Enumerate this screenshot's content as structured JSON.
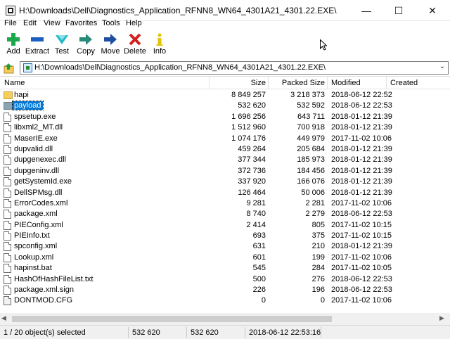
{
  "window": {
    "title": "H:\\Downloads\\Dell\\Diagnostics_Application_RFNN8_WN64_4301A21_4301.22.EXE\\",
    "minimize_glyph": "—",
    "maximize_glyph": "☐",
    "close_glyph": "✕"
  },
  "menu": {
    "file": "File",
    "edit": "Edit",
    "view": "View",
    "favorites": "Favorites",
    "tools": "Tools",
    "help": "Help"
  },
  "toolbar": {
    "add": "Add",
    "extract": "Extract",
    "test": "Test",
    "copy": "Copy",
    "move": "Move",
    "delete": "Delete",
    "info": "Info",
    "icons": [
      "plus-icon",
      "minus-icon",
      "test-icon",
      "copy-arrow-icon",
      "move-arrow-icon",
      "delete-x-icon",
      "info-icon"
    ],
    "colors": {
      "add": "#1aa84a",
      "extract": "#1d5fc0",
      "test": "#21b8c8",
      "copy": "#2a8a7a",
      "move": "#1d4ea0",
      "delete": "#d21f1f",
      "info": "#e6c200"
    }
  },
  "address": {
    "path": "H:\\Downloads\\Dell\\Diagnostics_Application_RFNN8_WN64_4301A21_4301.22.EXE\\",
    "dropdown_glyph": "⌄"
  },
  "columns": {
    "name": "Name",
    "size": "Size",
    "packed": "Packed Size",
    "modified": "Modified",
    "created": "Created"
  },
  "files": [
    {
      "name": "hapi",
      "size": "8 849 257",
      "packed": "3 218 373",
      "modified": "2018-06-12 22:52",
      "icon": "folder"
    },
    {
      "name": "payload",
      "size": "532 620",
      "packed": "532 592",
      "modified": "2018-06-12 22:53",
      "icon": "folder-selected",
      "selected": true
    },
    {
      "name": "spsetup.exe",
      "size": "1 696 256",
      "packed": "643 711",
      "modified": "2018-01-12 21:39",
      "icon": "file"
    },
    {
      "name": "libxml2_MT.dll",
      "size": "1 512 960",
      "packed": "700 918",
      "modified": "2018-01-12 21:39",
      "icon": "file"
    },
    {
      "name": "MaserIE.exe",
      "size": "1 074 176",
      "packed": "449 979",
      "modified": "2017-11-02 10:06",
      "icon": "file"
    },
    {
      "name": "dupvalid.dll",
      "size": "459 264",
      "packed": "205 684",
      "modified": "2018-01-12 21:39",
      "icon": "file"
    },
    {
      "name": "dupgenexec.dll",
      "size": "377 344",
      "packed": "185 973",
      "modified": "2018-01-12 21:39",
      "icon": "file"
    },
    {
      "name": "dupgeninv.dll",
      "size": "372 736",
      "packed": "184 456",
      "modified": "2018-01-12 21:39",
      "icon": "file"
    },
    {
      "name": "getSystemId.exe",
      "size": "337 920",
      "packed": "166 076",
      "modified": "2018-01-12 21:39",
      "icon": "file"
    },
    {
      "name": "DellSPMsg.dll",
      "size": "126 464",
      "packed": "50 006",
      "modified": "2018-01-12 21:39",
      "icon": "file"
    },
    {
      "name": "ErrorCodes.xml",
      "size": "9 281",
      "packed": "2 281",
      "modified": "2017-11-02 10:06",
      "icon": "file"
    },
    {
      "name": "package.xml",
      "size": "8 740",
      "packed": "2 279",
      "modified": "2018-06-12 22:53",
      "icon": "file"
    },
    {
      "name": "PIEConfig.xml",
      "size": "2 414",
      "packed": "805",
      "modified": "2017-11-02 10:15",
      "icon": "file"
    },
    {
      "name": "PIEInfo.txt",
      "size": "693",
      "packed": "375",
      "modified": "2017-11-02 10:15",
      "icon": "file"
    },
    {
      "name": "spconfig.xml",
      "size": "631",
      "packed": "210",
      "modified": "2018-01-12 21:39",
      "icon": "file"
    },
    {
      "name": "Lookup.xml",
      "size": "601",
      "packed": "199",
      "modified": "2017-11-02 10:06",
      "icon": "file"
    },
    {
      "name": "hapinst.bat",
      "size": "545",
      "packed": "284",
      "modified": "2017-11-02 10:05",
      "icon": "file"
    },
    {
      "name": "HashOfHashFileList.txt",
      "size": "500",
      "packed": "276",
      "modified": "2018-06-12 22:53",
      "icon": "file"
    },
    {
      "name": "package.xml.sign",
      "size": "226",
      "packed": "196",
      "modified": "2018-06-12 22:53",
      "icon": "file"
    },
    {
      "name": "DONTMOD.CFG",
      "size": "0",
      "packed": "0",
      "modified": "2017-11-02 10:06",
      "icon": "cfg"
    }
  ],
  "scrollbar": {
    "left_glyph": "◀",
    "right_glyph": "▶"
  },
  "status": {
    "selection": "1 / 20 object(s) selected",
    "size": "532 620",
    "packed": "532 620",
    "modified": "2018-06-12 22:53:16"
  }
}
